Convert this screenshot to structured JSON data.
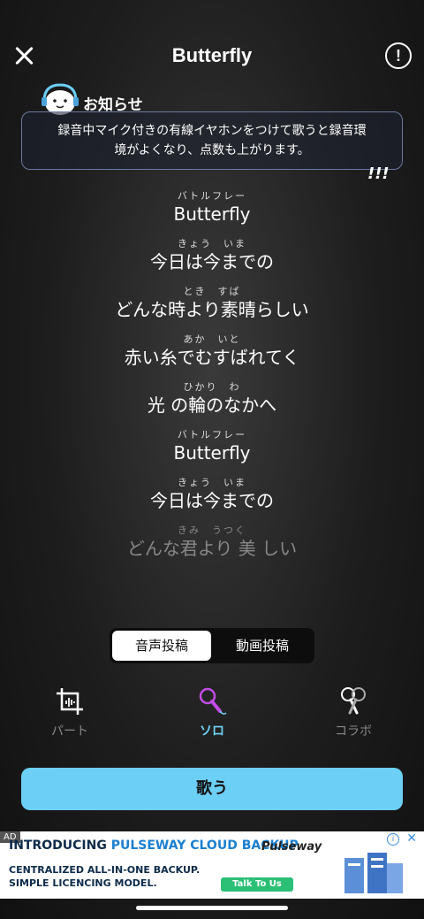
{
  "header": {
    "title": "Butterfly",
    "info_symbol": "!"
  },
  "notice": {
    "label": "お知らせ",
    "message_line1": "録音中マイク付きの有線イヤホンをつけて歌うと録音環",
    "message_line2": "境がよくなり、点数も上がります。",
    "exclaim": "!!!"
  },
  "lyrics": [
    {
      "ruby": "バトルフレー",
      "text": "Butterfly",
      "dim": false
    },
    {
      "ruby": "きょう　いま",
      "text": "今日は今までの",
      "dim": false
    },
    {
      "ruby": "とき　すば",
      "text": "どんな時より素晴らしい",
      "dim": false
    },
    {
      "ruby": "あか　いと",
      "text": "赤い糸でむすばれてく",
      "dim": false
    },
    {
      "ruby": "ひかり　わ",
      "text": "光 の輪のなかへ",
      "dim": false
    },
    {
      "ruby": "バトルフレー",
      "text": "Butterfly",
      "dim": false
    },
    {
      "ruby": "きょう　いま",
      "text": "今日は今までの",
      "dim": false
    },
    {
      "ruby": "きみ　うつく",
      "text": "どんな君より 美 しい",
      "dim": true
    }
  ],
  "post_toggle": {
    "audio_label": "音声投稿",
    "video_label": "動画投稿",
    "selected": "音声投稿"
  },
  "modes": {
    "part_label": "パート",
    "solo_label": "ソロ",
    "collab_label": "コラボ",
    "selected": "ソロ"
  },
  "sing_button": {
    "label": "歌う"
  },
  "ad": {
    "tag": "AD",
    "line1_prefix": "INTRODUCING",
    "line1_highlight": "PULSEWAY CLOUD BACKUP",
    "line2": "CENTRALIZED ALL-IN-ONE BACKUP.",
    "line3": "SIMPLE LICENCING MODEL.",
    "cta": "Talk To Us",
    "brand": "Pulseway",
    "info_symbol": "i",
    "close_symbol": "✕"
  },
  "colors": {
    "accent": "#6ccff6",
    "solo_active": "#6fd3f7"
  }
}
